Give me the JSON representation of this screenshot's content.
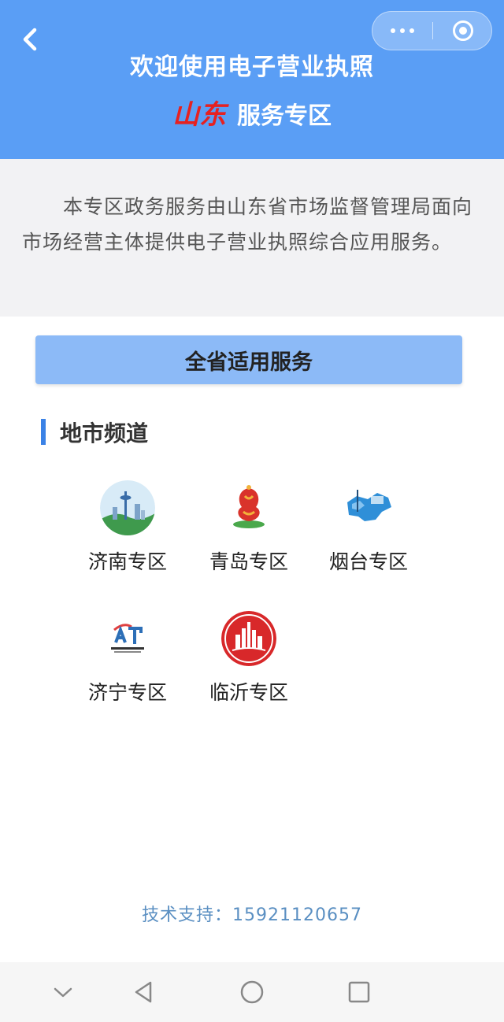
{
  "header": {
    "title_line1": "欢迎使用电子营业执照",
    "province": "山东",
    "zone_label": "服务专区",
    "bg_color": "#5a9ef5",
    "province_color": "#e62121",
    "icons": {
      "back": "chevron-left-icon",
      "more": "more-dots-icon",
      "close": "target-close-icon"
    }
  },
  "intro": {
    "text": "本专区政务服务由山东省市场监督管理局面向市场经营主体提供电子营业执照综合应用服务。"
  },
  "province_service": {
    "label": "全省适用服务"
  },
  "section": {
    "title": "地市频道",
    "accent": "#3b82e6"
  },
  "cities": [
    {
      "label": "济南专区",
      "icon": "jinan-logo-icon"
    },
    {
      "label": "青岛专区",
      "icon": "qingdao-logo-icon"
    },
    {
      "label": "烟台专区",
      "icon": "yantai-logo-icon"
    },
    {
      "label": "济宁专区",
      "icon": "jining-logo-icon"
    },
    {
      "label": "临沂专区",
      "icon": "linyi-logo-icon"
    }
  ],
  "footer": {
    "support": "技术支持：15921120657"
  },
  "system_nav": [
    "chevron-down-icon",
    "back-triangle-icon",
    "home-circle-icon",
    "recents-square-icon"
  ]
}
